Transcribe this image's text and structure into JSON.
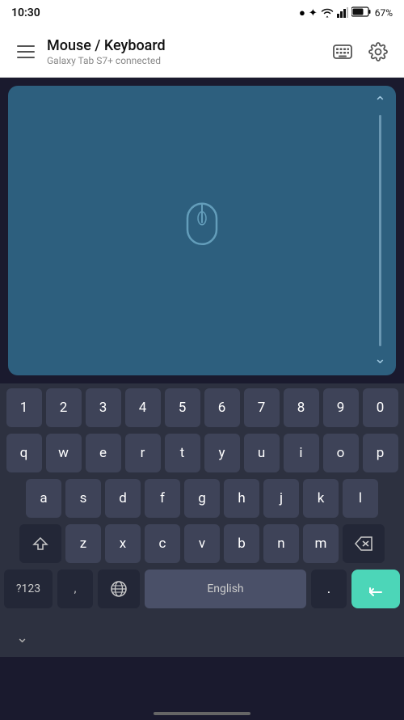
{
  "statusBar": {
    "time": "10:30",
    "icons": [
      "●",
      "🔵",
      "▲",
      "📶",
      "🔋"
    ],
    "battery": "67%"
  },
  "appBar": {
    "title": "Mouse / Keyboard",
    "subtitle": "Galaxy Tab S7+ connected"
  },
  "numberRow": [
    "1",
    "2",
    "3",
    "4",
    "5",
    "6",
    "7",
    "8",
    "9",
    "0"
  ],
  "row1": [
    "q",
    "w",
    "e",
    "r",
    "t",
    "y",
    "u",
    "i",
    "o",
    "p"
  ],
  "row2": [
    "a",
    "s",
    "d",
    "f",
    "g",
    "h",
    "j",
    "k",
    "l"
  ],
  "row3": [
    "z",
    "x",
    "c",
    "v",
    "b",
    "n",
    "m"
  ],
  "bottomRow": {
    "symbol": "?123",
    "comma": ",",
    "language": "English",
    "period": ".",
    "enter_icon": "⏎"
  },
  "icons": {
    "menu": "menu-icon",
    "keyboard": "keyboard-icon",
    "settings": "settings-icon",
    "mouse": "mouse-icon",
    "shift": "shift-icon",
    "backspace": "backspace-icon",
    "globe": "globe-icon",
    "enter": "enter-icon",
    "chevron_down": "chevron-down-icon",
    "chevron_up": "chevron-up-icon"
  },
  "colors": {
    "accent": "#4cd6b8",
    "trackpad": "#2d5f7e",
    "keyboard_bg": "#2d3140",
    "key": "#3e4358",
    "key_dark": "#232737"
  }
}
